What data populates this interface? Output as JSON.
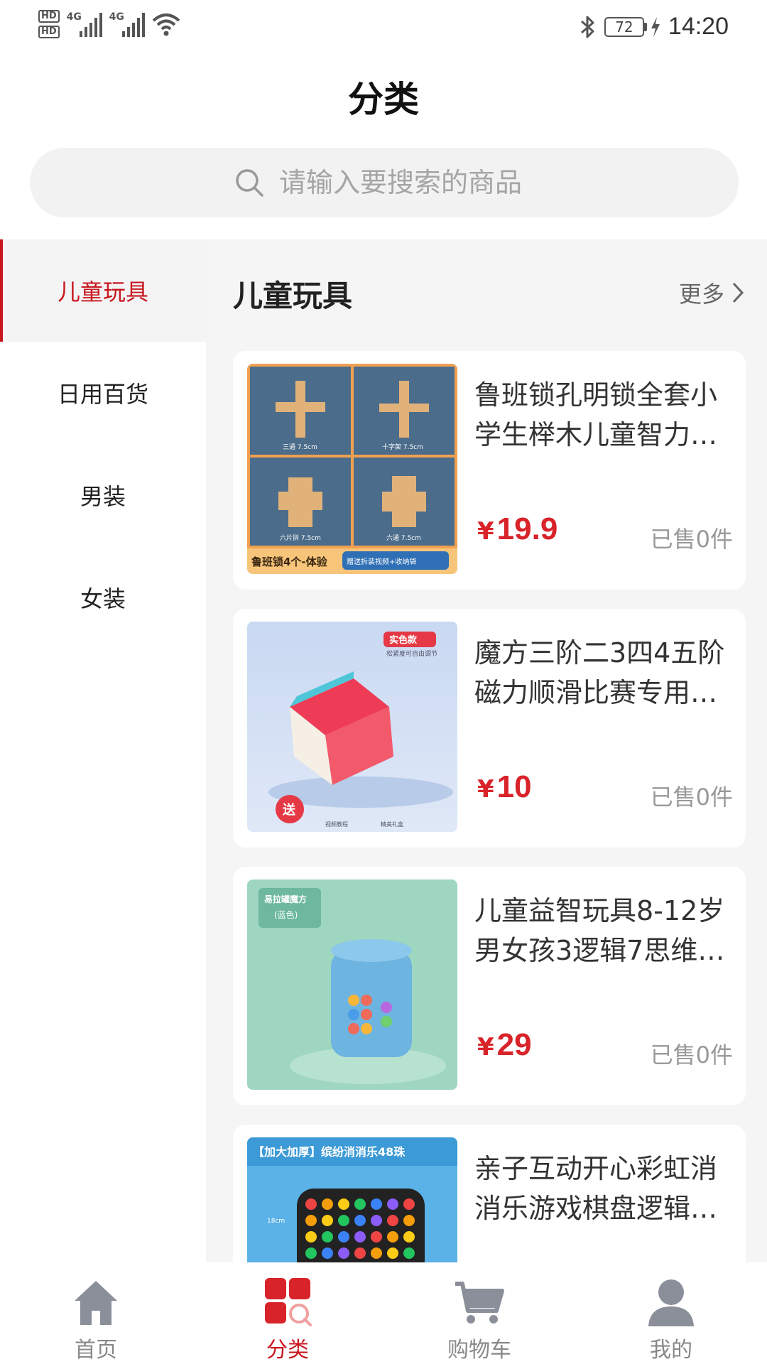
{
  "status_bar": {
    "hd1": "HD",
    "hd2": "HD",
    "net1": "4G",
    "net2": "4G",
    "battery": "72",
    "time": "14:20"
  },
  "page": {
    "title": "分类"
  },
  "search": {
    "placeholder": "请输入要搜索的商品"
  },
  "categories": [
    {
      "label": "儿童玩具",
      "active": true
    },
    {
      "label": "日用百货",
      "active": false
    },
    {
      "label": "男装",
      "active": false
    },
    {
      "label": "女装",
      "active": false
    }
  ],
  "section": {
    "title": "儿童玩具",
    "more": "更多"
  },
  "products": [
    {
      "title": "鲁班锁孔明锁全套小学生榉木儿童智力…",
      "currency": "¥",
      "price": "19.9",
      "sold": "已售0件",
      "image_text": "鲁班锁4个-体验",
      "image_badge": "赠送拆装视频+收纳袋",
      "image_caption_1": "三通 7.5cm",
      "image_caption_2": "十字架 7.5cm",
      "image_caption_3": "六片拼 7.5cm",
      "image_caption_4": "六通 7.5cm"
    },
    {
      "title": "魔方三阶二3四4五阶磁力顺滑比赛专用…",
      "currency": "¥",
      "price": "10",
      "sold": "已售0件",
      "image_text": "实色款",
      "image_badge": "松紧度可自由调节",
      "image_gift": "送",
      "image_caption_1": "视频教程",
      "image_caption_2": "精美礼盒"
    },
    {
      "title": "儿童益智玩具8-12岁男女孩3逻辑7思维…",
      "currency": "¥",
      "price": "29",
      "sold": "已售0件",
      "image_text": "易拉罐魔方",
      "image_badge": "(蓝色)"
    },
    {
      "title": "亲子互动开心彩虹消消乐游戏棋盘逻辑…",
      "currency": "¥",
      "price": "",
      "sold": "",
      "image_text": "【加大加厚】缤纷消消乐48珠",
      "image_badge": "18cm"
    }
  ],
  "tabs": [
    {
      "label": "首页",
      "icon": "home-icon",
      "active": false
    },
    {
      "label": "分类",
      "icon": "category-icon",
      "active": true
    },
    {
      "label": "购物车",
      "icon": "cart-icon",
      "active": false
    },
    {
      "label": "我的",
      "icon": "profile-icon",
      "active": false
    }
  ],
  "colors": {
    "accent": "#c8161e",
    "price": "#d9232a",
    "icon_gray": "#8a8f99"
  }
}
